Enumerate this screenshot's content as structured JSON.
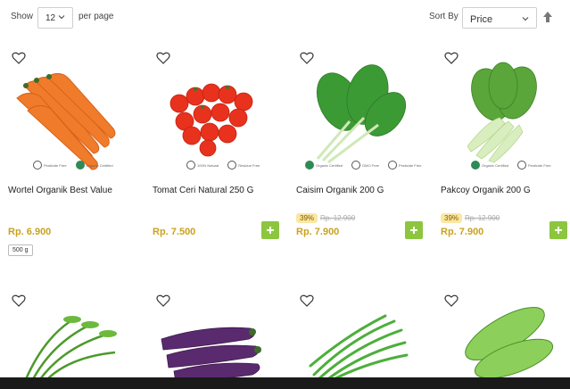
{
  "toolbar": {
    "show_label": "Show",
    "per_page_value": "12",
    "per_page_label": "per page",
    "sort_by_label": "Sort By",
    "sort_value": "Price"
  },
  "products": [
    {
      "name": "Wortel Organik Best Value",
      "price": "Rp. 6.900",
      "weight": "500 g",
      "icons": [
        "Pesticide Free",
        "Organic Certified"
      ]
    },
    {
      "name": "Tomat Ceri Natural 250 G",
      "price": "Rp. 7.500",
      "icons": [
        "100% Natural",
        "Residue Free"
      ]
    },
    {
      "name": "Caisim Organik 200 G",
      "discount": "39%",
      "old_price": "Rp. 12.900",
      "price": "Rp. 7.900",
      "icons": [
        "Organic Certified",
        "GMO Free",
        "Pesticide Free"
      ]
    },
    {
      "name": "Pakcoy Organik 200 G",
      "discount": "39%",
      "old_price": "Rp. 12.900",
      "price": "Rp. 7.900",
      "icons": [
        "Organic Certified",
        "Pesticide Free"
      ]
    }
  ],
  "second_row": [
    {
      "image": "kangkung"
    },
    {
      "image": "terong"
    },
    {
      "image": "buncis"
    },
    {
      "image": "timun"
    }
  ],
  "colors": {
    "price": "#caa21e",
    "add_button": "#8cc63f",
    "badge_bg": "#fbe7a2"
  }
}
